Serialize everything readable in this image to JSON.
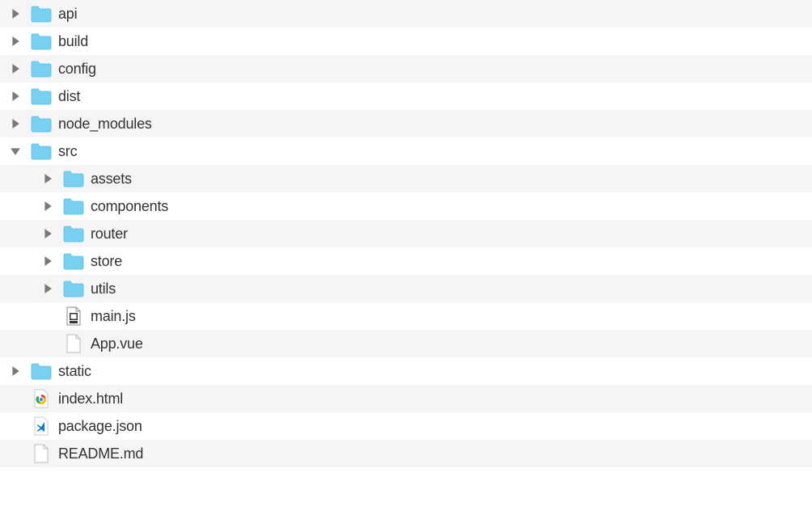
{
  "tree": {
    "nodes": [
      {
        "label": "api",
        "type": "folder",
        "expanded": false,
        "depth": 0,
        "alt": true
      },
      {
        "label": "build",
        "type": "folder",
        "expanded": false,
        "depth": 0,
        "alt": false
      },
      {
        "label": "config",
        "type": "folder",
        "expanded": false,
        "depth": 0,
        "alt": true
      },
      {
        "label": "dist",
        "type": "folder",
        "expanded": false,
        "depth": 0,
        "alt": false
      },
      {
        "label": "node_modules",
        "type": "folder",
        "expanded": false,
        "depth": 0,
        "alt": true
      },
      {
        "label": "src",
        "type": "folder",
        "expanded": true,
        "depth": 0,
        "alt": false
      },
      {
        "label": "assets",
        "type": "folder",
        "expanded": false,
        "depth": 1,
        "alt": true
      },
      {
        "label": "components",
        "type": "folder",
        "expanded": false,
        "depth": 1,
        "alt": false
      },
      {
        "label": "router",
        "type": "folder",
        "expanded": false,
        "depth": 1,
        "alt": true
      },
      {
        "label": "store",
        "type": "folder",
        "expanded": false,
        "depth": 1,
        "alt": false
      },
      {
        "label": "utils",
        "type": "folder",
        "expanded": false,
        "depth": 1,
        "alt": true
      },
      {
        "label": "main.js",
        "type": "file-js",
        "expanded": null,
        "depth": 1,
        "alt": false
      },
      {
        "label": "App.vue",
        "type": "file",
        "expanded": null,
        "depth": 1,
        "alt": true
      },
      {
        "label": "static",
        "type": "folder",
        "expanded": false,
        "depth": 0,
        "alt": false
      },
      {
        "label": "index.html",
        "type": "file-chrome",
        "expanded": null,
        "depth": 0,
        "alt": true
      },
      {
        "label": "package.json",
        "type": "file-vscode",
        "expanded": null,
        "depth": 0,
        "alt": false
      },
      {
        "label": "README.md",
        "type": "file",
        "expanded": null,
        "depth": 0,
        "alt": true
      }
    ]
  },
  "colors": {
    "folder": "#79d0f2",
    "folderStroke": "#53bfe4",
    "arrow": "#7a7a7a",
    "rowAlt": "#f5f5f5"
  }
}
